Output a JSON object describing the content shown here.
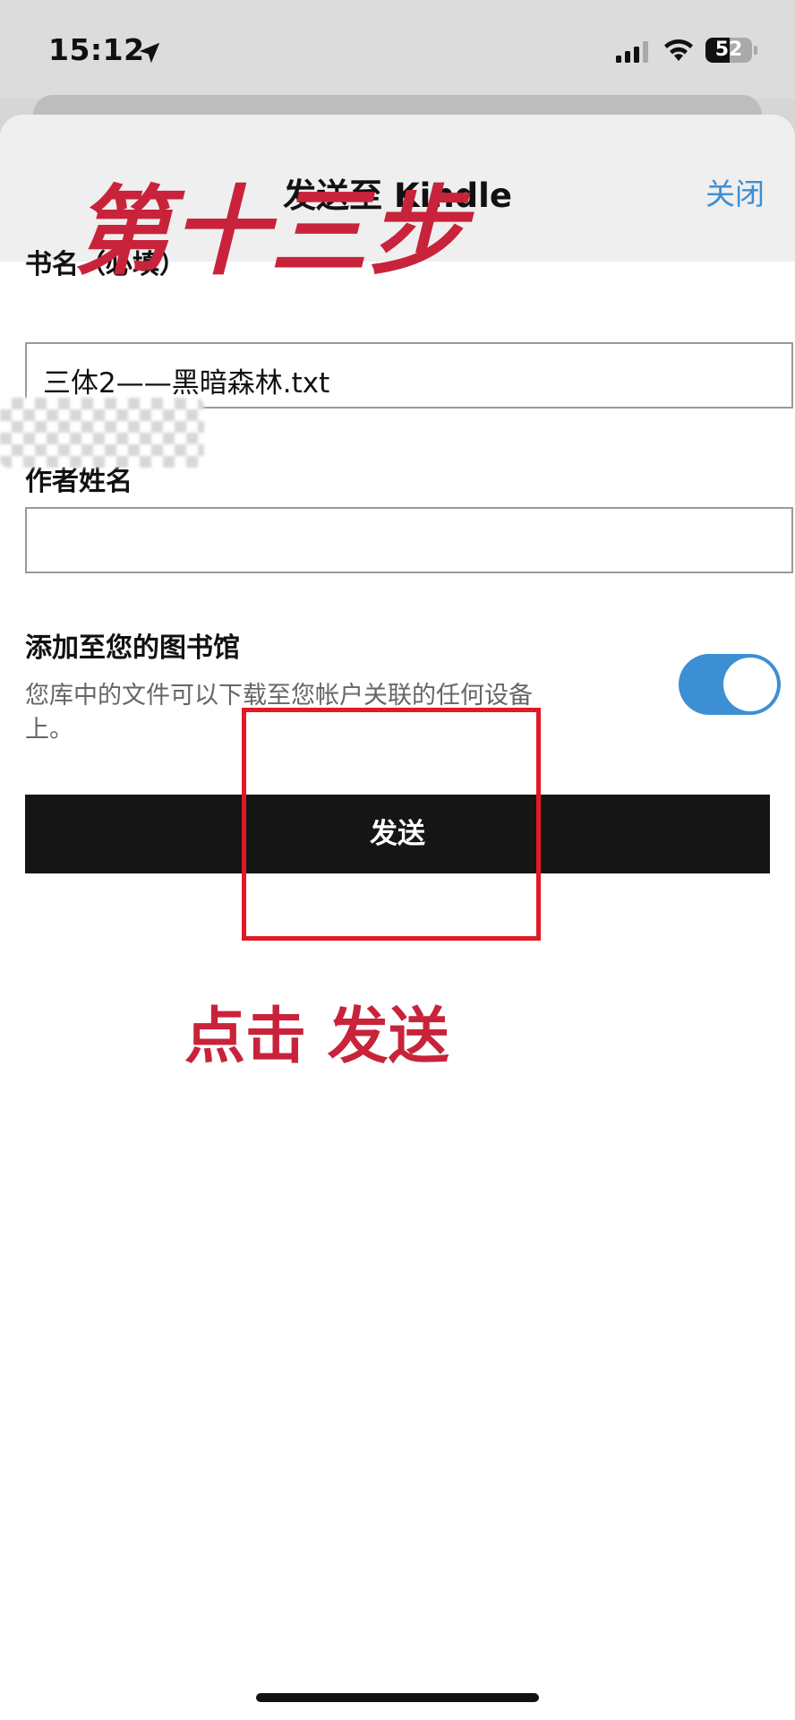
{
  "status_bar": {
    "time": "15:12",
    "battery_text": "52",
    "battery_level": 0.52,
    "location_icon": "location-arrow-icon",
    "signal_icon": "cellular-signal-icon",
    "wifi_icon": "wifi-icon"
  },
  "sheet": {
    "title": "发送至 Kindle",
    "close_label": "关闭"
  },
  "form": {
    "book_title_label": "书名（必填）",
    "book_title_value": "三体2——黑暗森林.txt",
    "author_label": "作者姓名",
    "author_value": ""
  },
  "library": {
    "title": "添加至您的图书馆",
    "description": "您库中的文件可以下载至您帐户关联的任何设备上。",
    "toggle_on": true
  },
  "send_button_label": "发送",
  "annotations": {
    "step_label": "第十三步",
    "hint": "点击 发送",
    "color": "#c8233a",
    "box_color": "#e01a24"
  },
  "colors": {
    "accent_blue": "#3d8fd4",
    "button_black": "#151515"
  }
}
